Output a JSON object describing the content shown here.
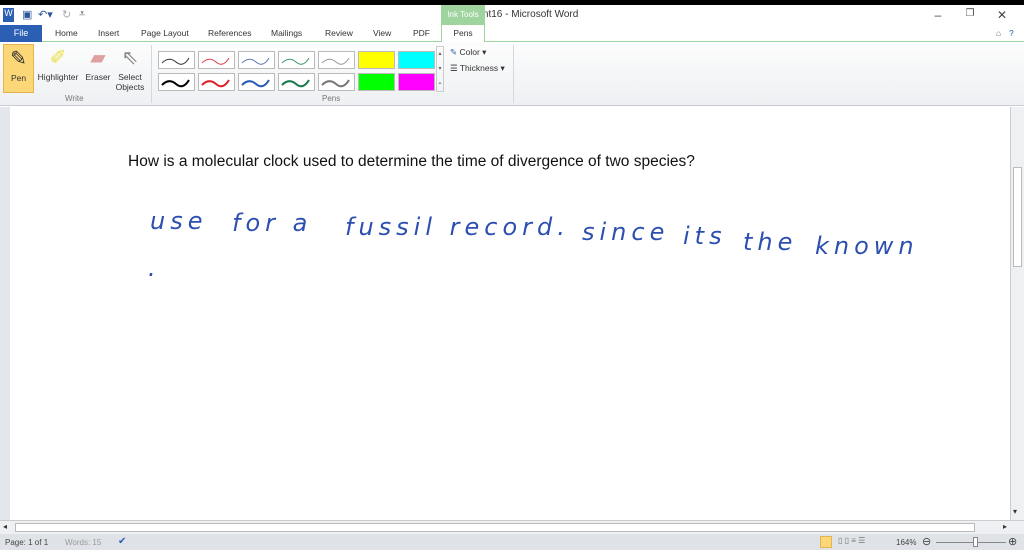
{
  "window": {
    "title": "Document16  -  Microsoft Word",
    "contextual_tab_group": "Ink Tools"
  },
  "tabs": [
    "File",
    "Home",
    "Insert",
    "Page Layout",
    "References",
    "Mailings",
    "Review",
    "View",
    "PDF",
    "Pens"
  ],
  "ribbon": {
    "write_buttons": [
      {
        "label": "Pen",
        "icon": "pen-icon"
      },
      {
        "label": "Highlighter",
        "icon": "highlighter-icon"
      },
      {
        "label": "Eraser",
        "icon": "eraser-icon"
      },
      {
        "label": "Select Objects",
        "icon": "cursor-icon"
      }
    ],
    "write_group": "Write",
    "pens_group": "Pens",
    "pen_colors_top": [
      "#333333",
      "#e0404a",
      "#5a7ab8",
      "#3a9a6a",
      "#999999",
      "#ffff00",
      "#00ffff"
    ],
    "pen_colors_bottom": [
      "#000000",
      "#e0202a",
      "#2a5ab8",
      "#1a7a4a",
      "#777777",
      "#00ff00",
      "#ff00ff"
    ],
    "color_label": "Color",
    "thickness_label": "Thickness"
  },
  "document": {
    "question": "How is a molecular clock used to determine the time of divergence of two species?",
    "handwriting": [
      "use",
      "for a",
      "fussil record.",
      "since",
      "its",
      "the",
      "known",
      "."
    ]
  },
  "status": {
    "page": "Page: 1 of 1",
    "words": "Words: 15",
    "zoom": "164%"
  }
}
